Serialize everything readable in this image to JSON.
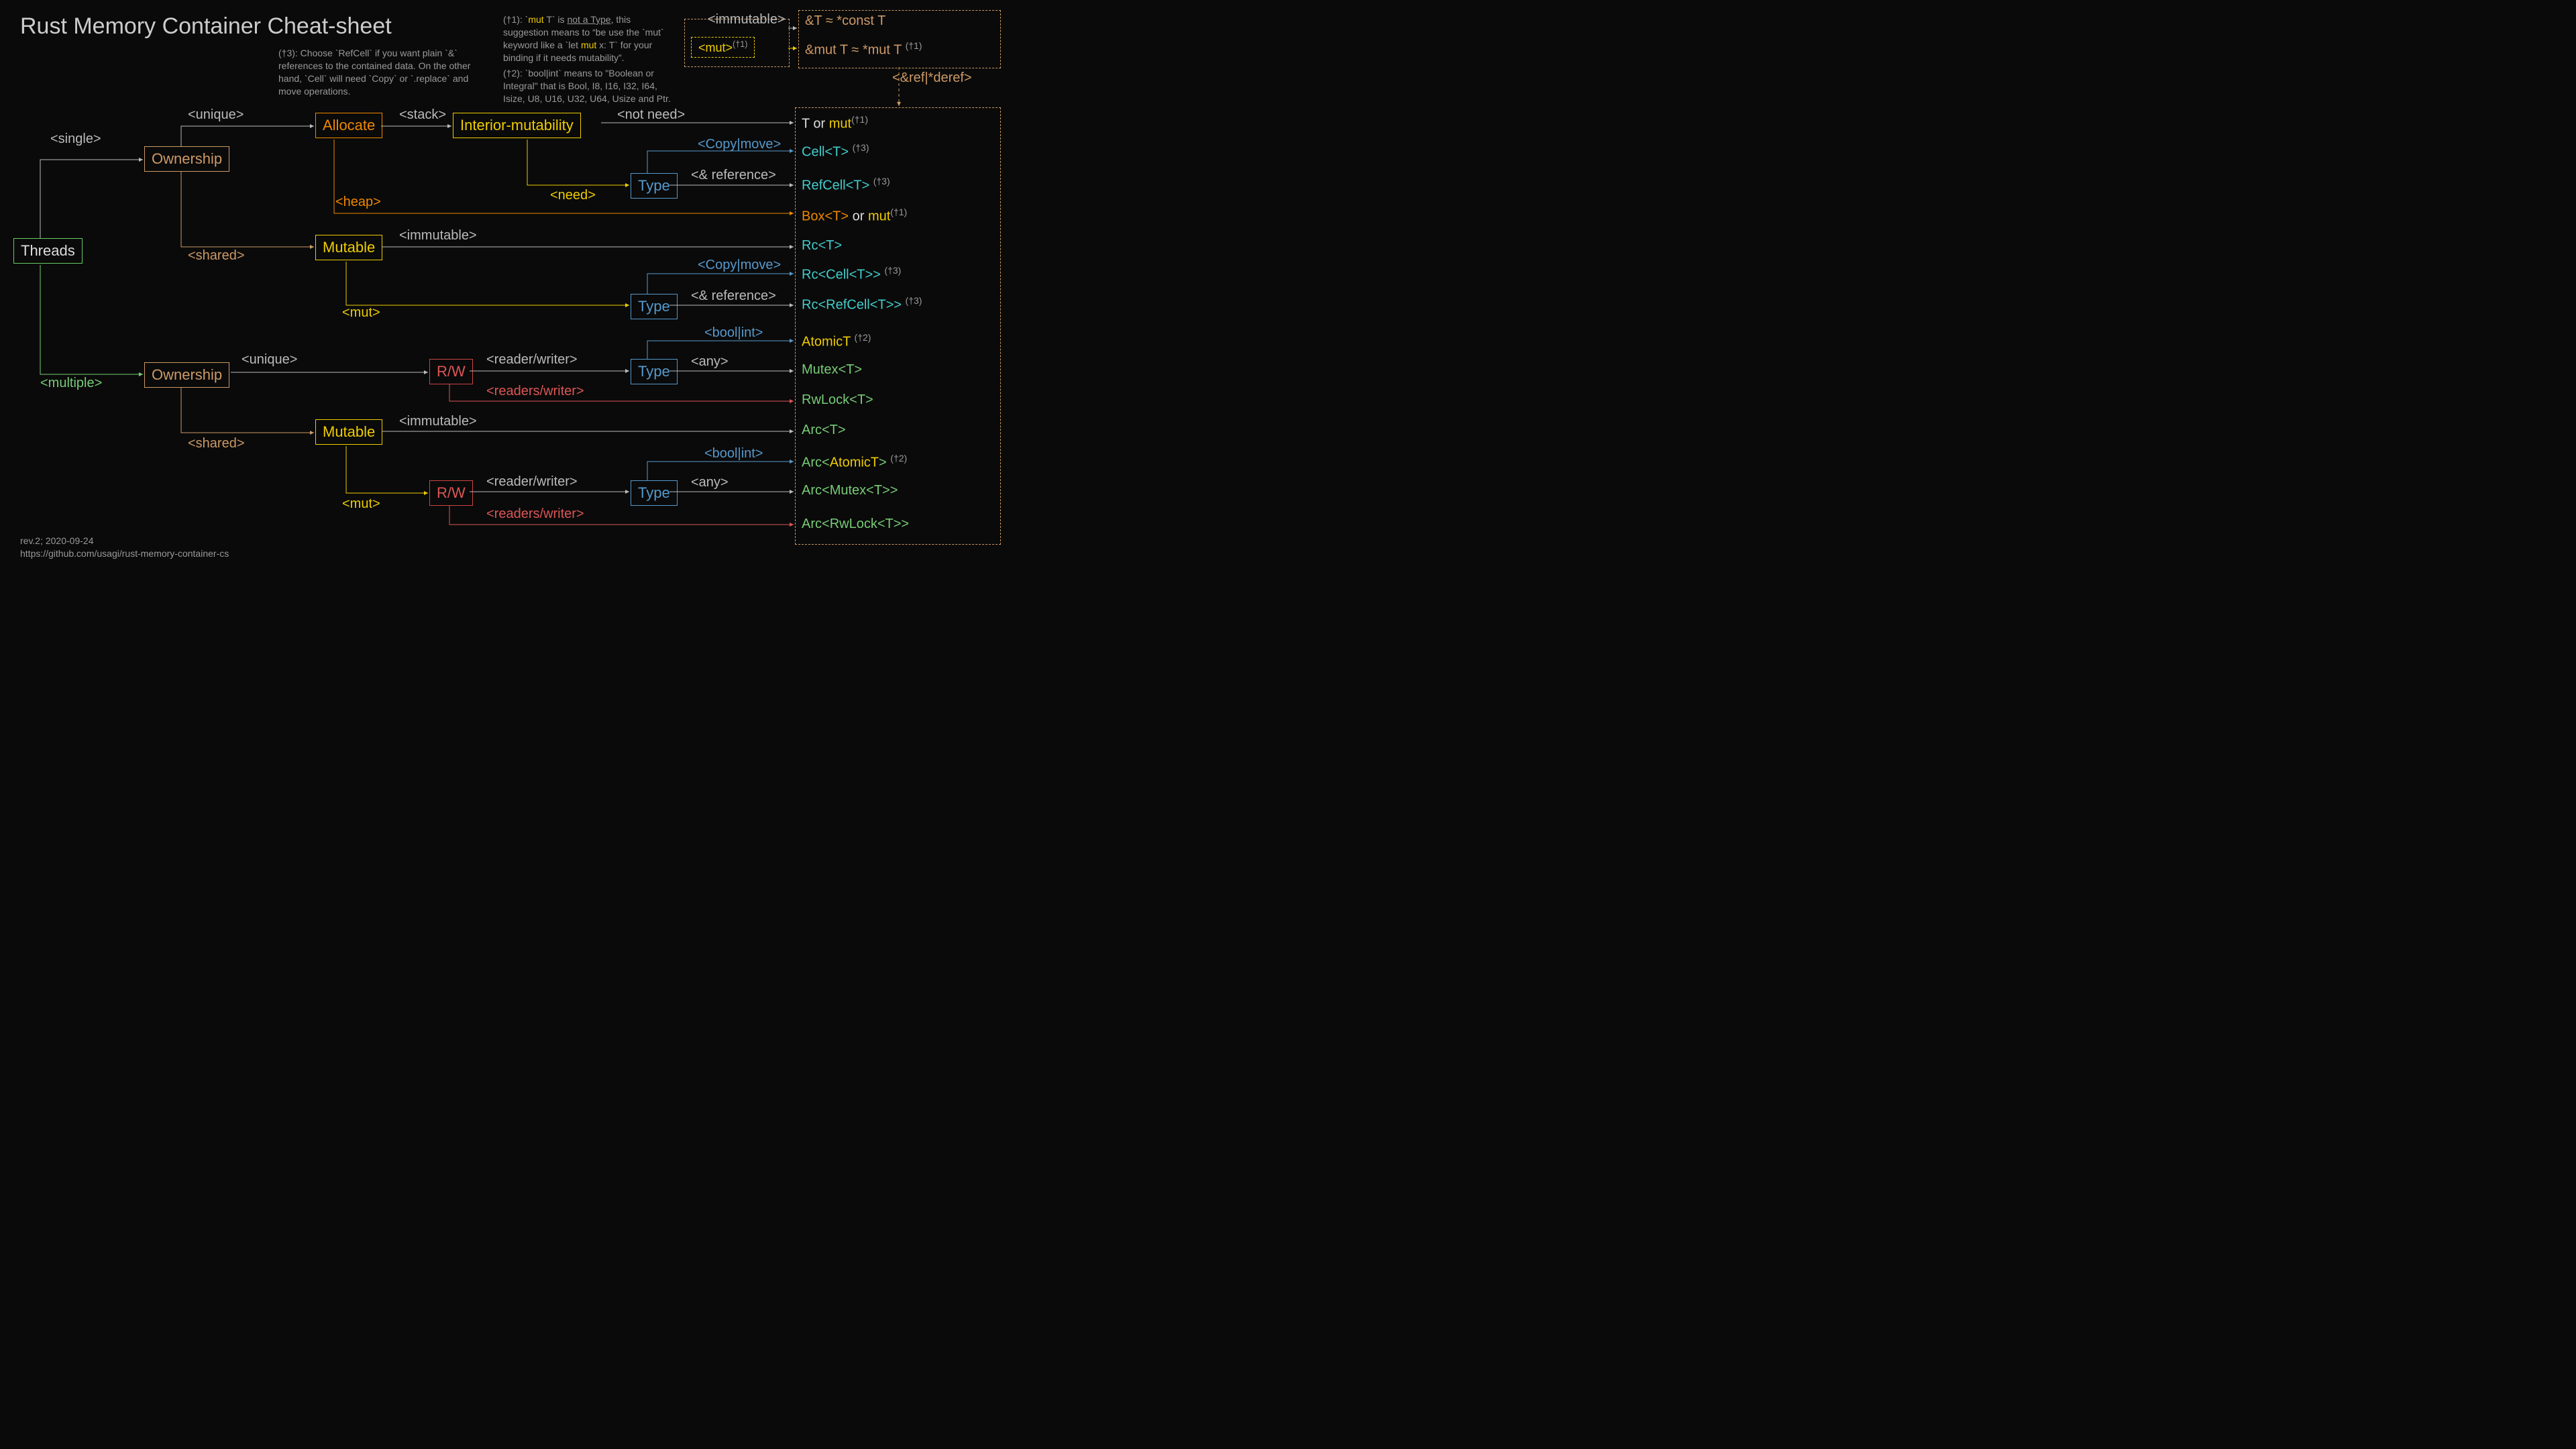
{
  "title": "Rust Memory Container Cheat-sheet",
  "footnotes": {
    "f3": "(†3): Choose `RefCell` if you want plain `&` references to the contained data. On the other hand, `Cell` will need `Copy` or `.replace` and move operations.",
    "f1": "(†1): `mut T` is not a Type, this suggestion means to \"be use the `mut` keyword like a `let mut x: T` for your binding if it needs mutability\".",
    "f2": "(†2): `bool|int` means to \"Boolean or Integral\" that is Bool, I8, I16, I32, I64, Isize, U8, U16, U32, U64, Usize and Ptr."
  },
  "credits": {
    "rev": "rev.2; 2020-09-24",
    "url": "https://github.com/usagi/rust-memory-container-cs"
  },
  "nodes": {
    "threads": "Threads",
    "ownership1": "Ownership",
    "ownership2": "Ownership",
    "allocate": "Allocate",
    "interior": "Interior-mutability",
    "mutable1": "Mutable",
    "mutable2": "Mutable",
    "type1": "Type",
    "type2": "Type",
    "type3": "Type",
    "type4": "Type",
    "rw1": "R/W",
    "rw2": "R/W",
    "mutbox": "<mut>"
  },
  "edges": {
    "single": "<single>",
    "multiple": "<multiple>",
    "unique1": "<unique>",
    "shared1": "<shared>",
    "unique2": "<unique>",
    "shared2": "<shared>",
    "stack": "<stack>",
    "heap": "<heap>",
    "notneed": "<not need>",
    "need": "<need>",
    "copy1": "<Copy|move>",
    "ref1": "<& reference>",
    "imm1": "<immutable>",
    "mut1": "<mut>",
    "copy2": "<Copy|move>",
    "ref2": "<& reference>",
    "rw_one1": "<reader/writer>",
    "rw_many1": "<readers/writer>",
    "bool1": "<bool|int>",
    "any1": "<any>",
    "imm2": "<immutable>",
    "mut2": "<mut>",
    "rw_one2": "<reader/writer>",
    "rw_many2": "<readers/writer>",
    "bool2": "<bool|int>",
    "any2": "<any>",
    "top_imm": "<immutable>",
    "ref_deref": "<&ref|*deref>"
  },
  "tops": {
    "t_const": "&T ≈ *const T",
    "t_mut_pre": "&mut T ≈ *mut T ",
    "t_mut_sup": "(†1)"
  },
  "results": {
    "r1_pre": "T or ",
    "r1_mut": "mut",
    "r1_sup": "(†1)",
    "r2": "Cell<T>",
    "r2_sup": "(†3)",
    "r3": "RefCell<T>",
    "r3_sup": "(†3)",
    "r4_pre": "Box<T>",
    "r4_or": " or ",
    "r4_mut": "mut",
    "r4_sup": "(†1)",
    "r5": "Rc<T>",
    "r6": "Rc<Cell<T>>",
    "r6_sup": "(†3)",
    "r7": "Rc<RefCell<T>>",
    "r7_sup": "(†3)",
    "r8": "AtomicT",
    "r8_sup": "(†2)",
    "r9": "Mutex<T>",
    "r10": "RwLock<T>",
    "r11": "Arc<T>",
    "r12_a": "Arc<",
    "r12_b": "AtomicT",
    "r12_c": ">",
    "r12_sup": "(†2)",
    "r13_a": "Arc<",
    "r13_b": "Mutex<T>",
    "r13_c": ">",
    "r14_a": "Arc<",
    "r14_b": "RwLock<T>",
    "r14_c": ">"
  }
}
